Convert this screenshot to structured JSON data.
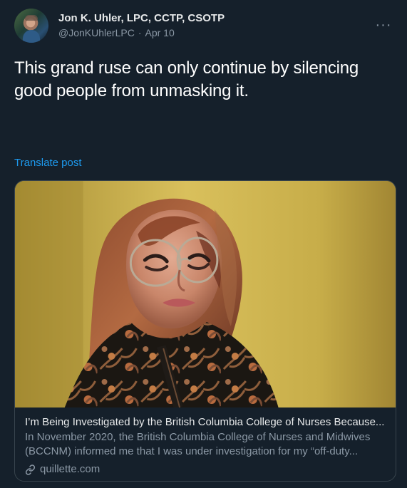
{
  "author": {
    "display_name": "Jon K. Uhler, LPC, CCTP, CSOTP",
    "handle": "@JonKUhlerLPC",
    "date": "Apr 10",
    "separator": "·"
  },
  "post": {
    "text": "This grand ruse can only continue by silencing good people from unmasking it.",
    "translate_label": "Translate post",
    "more_label": "···"
  },
  "link_card": {
    "title": "I’m Being Investigated by the British Columbia College of Nurses Because...",
    "description": "In November 2020, the British Columbia College of Nurses and Midwives (BCCNM) informed me that I was under investigation for my “off-duty...",
    "domain": "quillette.com"
  },
  "colors": {
    "background": "#15202b",
    "primary_text": "#e7e9ea",
    "secondary_text": "#8b98a5",
    "link": "#1d9bf0",
    "card_border": "#38444d"
  },
  "icons": {
    "avatar": "profile-photo",
    "more": "more-options-icon",
    "link": "link-icon"
  }
}
